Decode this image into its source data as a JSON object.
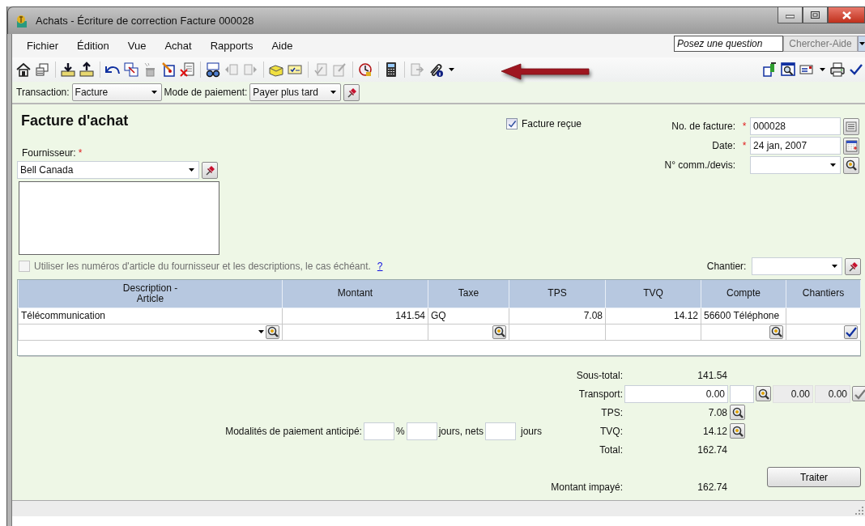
{
  "window": {
    "title": "Achats - Écriture de correction Facture 000028"
  },
  "menu": [
    {
      "label": "Fichier"
    },
    {
      "label": "Édition"
    },
    {
      "label": "Vue"
    },
    {
      "label": "Achat"
    },
    {
      "label": "Rapports"
    },
    {
      "label": "Aide"
    }
  ],
  "help_search": {
    "placeholder": "Posez une question",
    "button": "Chercher-Aide"
  },
  "transaction_bar": {
    "transaction_label": "Transaction:",
    "transaction": "Facture",
    "payment_label": "Mode de paiement:",
    "payment": "Payer plus tard"
  },
  "header": {
    "title": "Facture d'achat",
    "supplier_label": "Fournisseur:",
    "supplier_required": "*",
    "supplier": "Bell Canada",
    "invoice_received": {
      "label": "Facture reçue",
      "checked": true
    },
    "fields": [
      {
        "kind": "number",
        "label": "No. de facture:",
        "required": "*",
        "value": "000028"
      },
      {
        "kind": "date",
        "label": "Date:",
        "required": "*",
        "value": "24 jan, 2007"
      },
      {
        "kind": "lookup",
        "label": "N° comm./devis:"
      }
    ]
  },
  "supplier_numbers": {
    "label": "Utiliser les numéros d'article du fournisseur et les descriptions, le cas échéant.",
    "checked": false,
    "disabled": true,
    "help": "?"
  },
  "job": {
    "label": "Chantier:"
  },
  "table": {
    "columns": [
      "Description -\nArticle",
      "Montant",
      "Taxe",
      "TPS",
      "TVQ",
      "Compte",
      "Chantiers"
    ],
    "rows": [
      {
        "cells": [
          "Télécommunication",
          "141.54",
          "GQ",
          "7.08",
          "14.12",
          "56600 Téléphone"
        ]
      }
    ]
  },
  "terms": {
    "label": "Modalités de paiement anticipé:",
    "percent": "%",
    "days_label": "jours, nets",
    "net_label": "jours"
  },
  "totals": [
    {
      "kind": "plain",
      "label": "Sous-total:",
      "value": "141.54"
    },
    {
      "kind": "transport",
      "label": "Transport:",
      "value": "0.00",
      "tps": "0.00",
      "tvq": "0.00"
    },
    {
      "kind": "tax",
      "label": "TPS:",
      "value": "7.08"
    },
    {
      "kind": "tax",
      "label": "TVQ:",
      "value": "14.12"
    },
    {
      "kind": "plain",
      "label": "Total:",
      "value": "162.74"
    },
    {
      "kind": "unpaid",
      "label": "Montant impayé:",
      "value": "162.74"
    }
  ],
  "process_button": "Traiter"
}
